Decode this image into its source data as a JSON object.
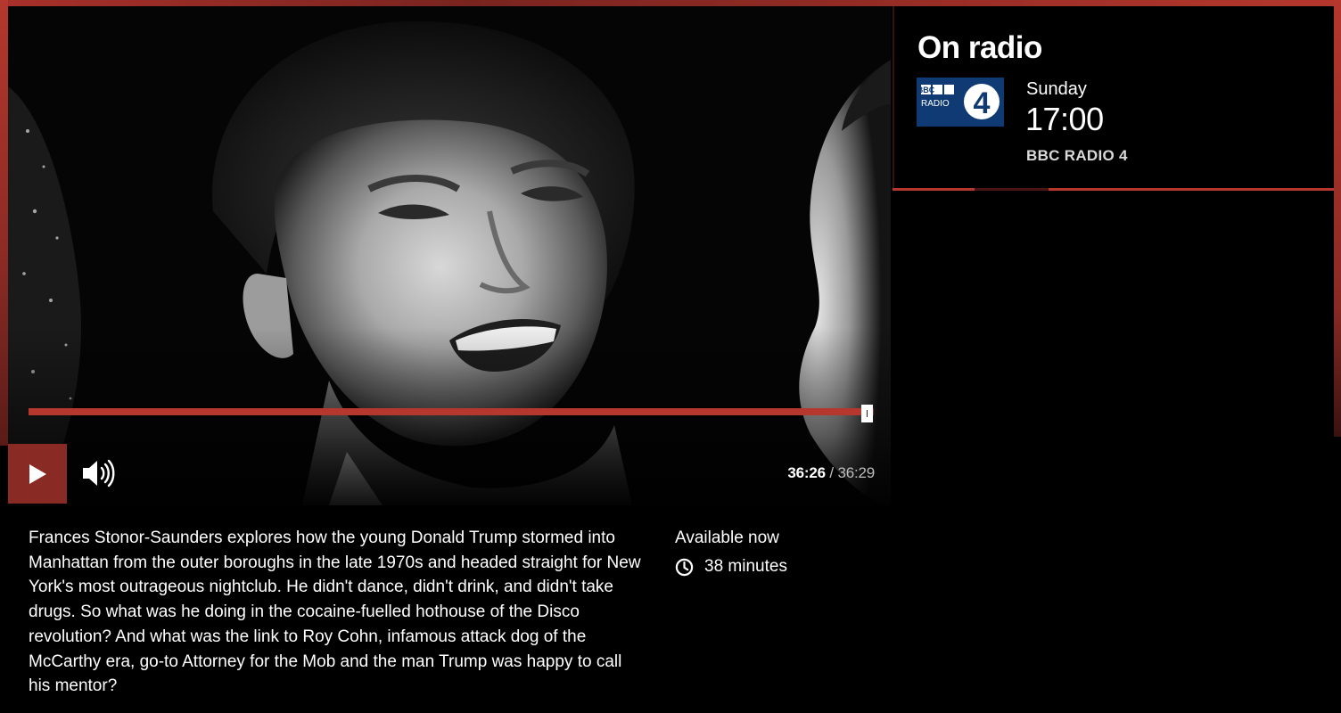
{
  "player": {
    "progress_fraction": 0.9986,
    "current_time": "36:26",
    "separator": "/",
    "total_time": "36:29"
  },
  "episode": {
    "description": "Frances Stonor-Saunders explores how the young Donald Trump stormed into Manhattan from the outer boroughs in the late 1970s and headed straight for New York's most outrageous nightclub. He didn't dance, didn't drink, and didn't take drugs. So what was he doing in the cocaine-fuelled hothouse of the Disco revolution? And what was the link to Roy Cohn, infamous attack dog of the McCarthy era, go-to Attorney for the Mob and the man Trump was happy to call his mentor?",
    "availability": "Available now",
    "duration": "38 minutes"
  },
  "on_radio": {
    "title": "On radio",
    "logo_text_top": "BBC",
    "logo_text_bottom": "RADIO",
    "logo_number": "4",
    "day": "Sunday",
    "time": "17:00",
    "station": "BBC RADIO 4"
  },
  "icons": {
    "play": "play-icon",
    "volume": "volume-icon",
    "clock": "clock-icon",
    "logo": "bbc-radio-4-logo"
  },
  "colors": {
    "accent": "#b5372d",
    "accent_dark": "#8a2a24",
    "radio4_blue": "#0f3a73",
    "background": "#000000"
  }
}
